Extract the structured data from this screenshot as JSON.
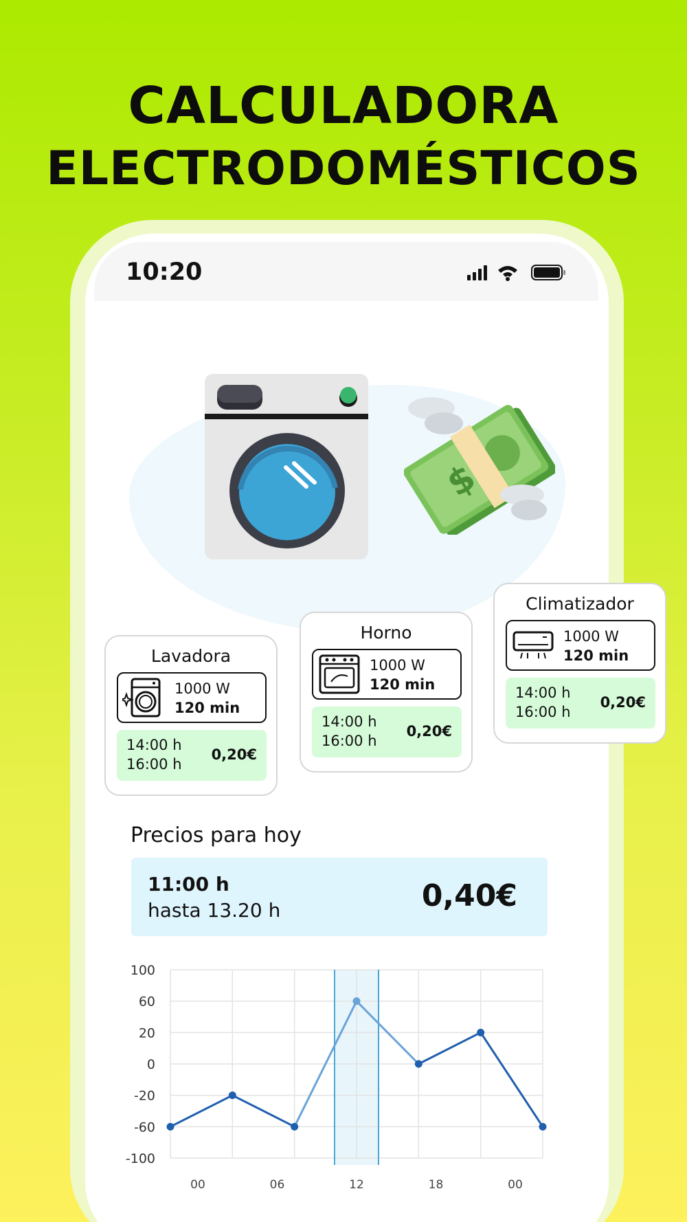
{
  "headline": {
    "line1": "CALCULADORA",
    "line2": "ELECTRODOMÉSTICOS"
  },
  "status_bar": {
    "time": "10:20",
    "icons": [
      "signal-icon",
      "wifi-icon",
      "battery-icon"
    ]
  },
  "illustration": {
    "items": [
      "washing-machine-icon",
      "flying-money-icon"
    ]
  },
  "cards": [
    {
      "title": "Lavadora",
      "icon": "washing-machine-icon",
      "power": "1000 W",
      "duration": "120 min",
      "time_start": "14:00 h",
      "time_end": "16:00 h",
      "price": "0,20€"
    },
    {
      "title": "Horno",
      "icon": "oven-icon",
      "power": "1000 W",
      "duration": "120 min",
      "time_start": "14:00 h",
      "time_end": "16:00 h",
      "price": "0,20€"
    },
    {
      "title": "Climatizador",
      "icon": "air-conditioner-icon",
      "power": "1000 W",
      "duration": "120 min",
      "time_start": "14:00 h",
      "time_end": "16:00 h",
      "price": "0,20€"
    }
  ],
  "prices": {
    "title": "Precios para hoy",
    "hour": "11:00 h",
    "until": "hasta 13.20 h",
    "value": "0,40€"
  },
  "colors": {
    "accent_green": "#acea00",
    "card_price_bg": "#d5fbd9",
    "price_box_bg": "#dff5fd",
    "line": "#1f5fad",
    "highlight": "#4aa6d8"
  },
  "chart_data": {
    "type": "line",
    "x_tick_labels": [
      "00",
      "06",
      "12",
      "18",
      "00"
    ],
    "y_tick_labels": [
      "100",
      "60",
      "20",
      "0",
      "-20",
      "-60",
      "-100"
    ],
    "ylim": [
      -100,
      100
    ],
    "grid": true,
    "series": [
      {
        "points": [
          {
            "x": 0,
            "y": -60
          },
          {
            "x": 1,
            "y": -20
          },
          {
            "x": 2,
            "y": -60
          },
          {
            "x": 3,
            "y": 60
          },
          {
            "x": 4,
            "y": 0
          },
          {
            "x": 5,
            "y": 20
          },
          {
            "x": 6,
            "y": -60
          }
        ]
      }
    ],
    "highlight_x": 3
  }
}
